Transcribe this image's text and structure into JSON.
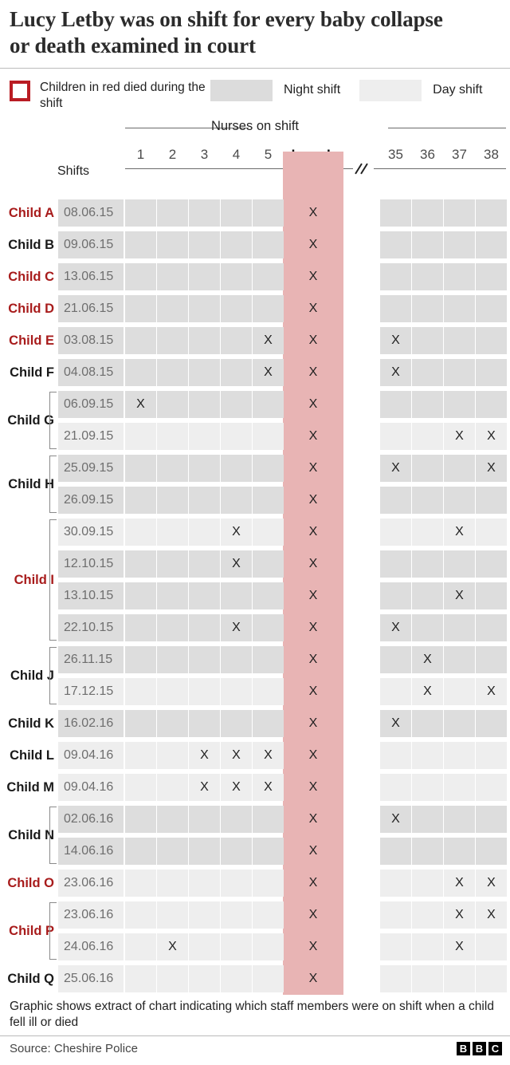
{
  "title": "Lucy Letby was on shift for every baby collapse or death examined in court",
  "legend": {
    "red_note": "Children in red died during the shift",
    "night_label": "Night shift",
    "day_label": "Day shift",
    "night_color": "#dcdcdc",
    "day_color": "#eeeeee",
    "red_color": "#b91c23",
    "lucy_column_color": "#e8b4b4"
  },
  "header": {
    "nurses_on_shift": "Nurses on shift",
    "shifts_label": "Shifts",
    "columns_left": [
      "1",
      "2",
      "3",
      "4",
      "5"
    ],
    "lucy_column": "Lucy L",
    "columns_right": [
      "35",
      "36",
      "37",
      "38"
    ]
  },
  "footnote": "Graphic shows extract of chart indicating which staff members were on shift when a child fell ill or died",
  "source": "Source: Cheshire Police",
  "brand": [
    "B",
    "B",
    "C"
  ],
  "chart_data": {
    "type": "table",
    "title": "Lucy Letby was on shift for every baby collapse or death examined in court",
    "columns": [
      "1",
      "2",
      "3",
      "4",
      "5",
      "Lucy L",
      "35",
      "36",
      "37",
      "38"
    ],
    "mark": "X",
    "shift_types": [
      "night",
      "day"
    ],
    "children": [
      {
        "label": "Child A",
        "died": true,
        "rows": [
          {
            "date": "08.06.15",
            "shift": "night",
            "marks": [
              "Lucy L"
            ]
          }
        ]
      },
      {
        "label": "Child B",
        "died": false,
        "rows": [
          {
            "date": "09.06.15",
            "shift": "night",
            "marks": [
              "Lucy L"
            ]
          }
        ]
      },
      {
        "label": "Child C",
        "died": true,
        "rows": [
          {
            "date": "13.06.15",
            "shift": "night",
            "marks": [
              "Lucy L"
            ]
          }
        ]
      },
      {
        "label": "Child D",
        "died": true,
        "rows": [
          {
            "date": "21.06.15",
            "shift": "night",
            "marks": [
              "Lucy L"
            ]
          }
        ]
      },
      {
        "label": "Child E",
        "died": true,
        "rows": [
          {
            "date": "03.08.15",
            "shift": "night",
            "marks": [
              "5",
              "Lucy L",
              "35"
            ]
          }
        ]
      },
      {
        "label": "Child F",
        "died": false,
        "rows": [
          {
            "date": "04.08.15",
            "shift": "night",
            "marks": [
              "5",
              "Lucy L",
              "35"
            ]
          }
        ]
      },
      {
        "label": "Child G",
        "died": false,
        "rows": [
          {
            "date": "06.09.15",
            "shift": "night",
            "marks": [
              "1",
              "Lucy L"
            ]
          },
          {
            "date": "21.09.15",
            "shift": "day",
            "marks": [
              "Lucy L",
              "37",
              "38"
            ]
          }
        ]
      },
      {
        "label": "Child H",
        "died": false,
        "rows": [
          {
            "date": "25.09.15",
            "shift": "night",
            "marks": [
              "Lucy L",
              "35",
              "38"
            ]
          },
          {
            "date": "26.09.15",
            "shift": "night",
            "marks": [
              "Lucy L"
            ]
          }
        ]
      },
      {
        "label": "Child I",
        "died": true,
        "rows": [
          {
            "date": "30.09.15",
            "shift": "day",
            "marks": [
              "4",
              "Lucy L",
              "37"
            ]
          },
          {
            "date": "12.10.15",
            "shift": "night",
            "marks": [
              "4",
              "Lucy L"
            ]
          },
          {
            "date": "13.10.15",
            "shift": "night",
            "marks": [
              "Lucy L",
              "37"
            ]
          },
          {
            "date": "22.10.15",
            "shift": "night",
            "marks": [
              "4",
              "Lucy L",
              "35"
            ]
          }
        ]
      },
      {
        "label": "Child J",
        "died": false,
        "rows": [
          {
            "date": "26.11.15",
            "shift": "night",
            "marks": [
              "Lucy L",
              "36"
            ]
          },
          {
            "date": "17.12.15",
            "shift": "day",
            "marks": [
              "Lucy L",
              "36",
              "38"
            ]
          }
        ]
      },
      {
        "label": "Child K",
        "died": false,
        "rows": [
          {
            "date": "16.02.16",
            "shift": "night",
            "marks": [
              "Lucy L",
              "35"
            ]
          }
        ]
      },
      {
        "label": "Child L",
        "died": false,
        "rows": [
          {
            "date": "09.04.16",
            "shift": "day",
            "marks": [
              "3",
              "4",
              "5",
              "Lucy L"
            ]
          }
        ]
      },
      {
        "label": "Child M",
        "died": false,
        "rows": [
          {
            "date": "09.04.16",
            "shift": "day",
            "marks": [
              "3",
              "4",
              "5",
              "Lucy L"
            ]
          }
        ]
      },
      {
        "label": "Child N",
        "died": false,
        "rows": [
          {
            "date": "02.06.16",
            "shift": "night",
            "marks": [
              "Lucy L",
              "35"
            ]
          },
          {
            "date": "14.06.16",
            "shift": "night",
            "marks": [
              "Lucy L"
            ]
          }
        ]
      },
      {
        "label": "Child O",
        "died": true,
        "rows": [
          {
            "date": "23.06.16",
            "shift": "day",
            "marks": [
              "Lucy L",
              "37",
              "38"
            ]
          }
        ]
      },
      {
        "label": "Child P",
        "died": true,
        "rows": [
          {
            "date": "23.06.16",
            "shift": "day",
            "marks": [
              "Lucy L",
              "37",
              "38"
            ]
          },
          {
            "date": "24.06.16",
            "shift": "day",
            "marks": [
              "2",
              "Lucy L",
              "37"
            ]
          }
        ]
      },
      {
        "label": "Child Q",
        "died": false,
        "rows": [
          {
            "date": "25.06.16",
            "shift": "day",
            "marks": [
              "Lucy L"
            ]
          }
        ]
      }
    ]
  }
}
